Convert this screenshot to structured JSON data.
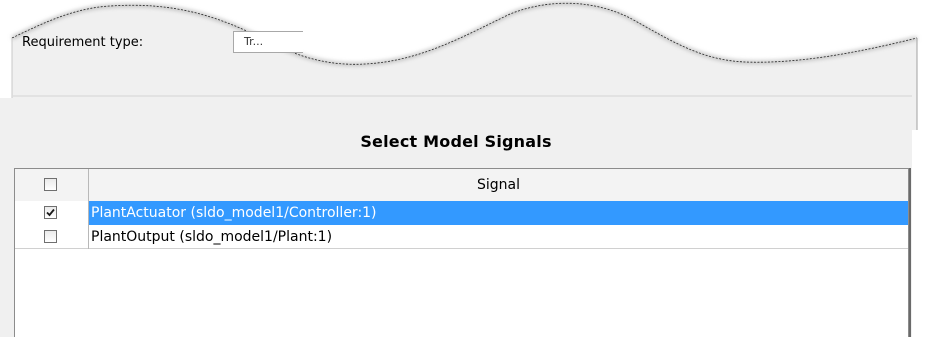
{
  "requirement": {
    "label": "Requirement type:",
    "value_fragment": "Tr..."
  },
  "panel": {
    "title": "Select Model Signals"
  },
  "table": {
    "header": {
      "signal_label": "Signal",
      "select_all_checked": false
    },
    "rows": [
      {
        "checked": true,
        "signal": "PlantActuator (sldo_model1/Controller:1)",
        "selected": true
      },
      {
        "checked": false,
        "signal": "PlantOutput (sldo_model1/Plant:1)",
        "selected": false
      }
    ]
  },
  "colors": {
    "selection": "#3399ff",
    "panel_background": "#f0f0f0",
    "grid_border": "#8c8c8c"
  }
}
